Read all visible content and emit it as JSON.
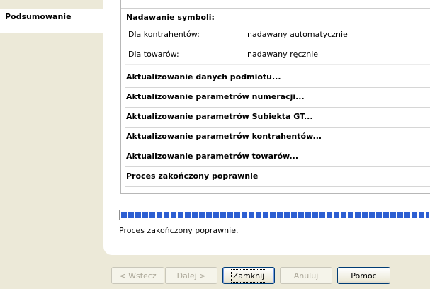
{
  "nav": {
    "items": [
      {
        "label": "Podsumowanie"
      }
    ]
  },
  "log": {
    "items": [
      {
        "type": "header",
        "label": "Nadawanie symboli:"
      },
      {
        "type": "kv",
        "key": "Dla kontrahentów:",
        "value": "nadawany automatycznie"
      },
      {
        "type": "kv",
        "key": "Dla towarów:",
        "value": "nadawany ręcznie"
      },
      {
        "type": "header",
        "label": "Aktualizowanie danych podmiotu..."
      },
      {
        "type": "header",
        "label": "Aktualizowanie parametrów numeracji..."
      },
      {
        "type": "header",
        "label": "Aktualizowanie parametrów Subiekta GT..."
      },
      {
        "type": "header",
        "label": "Aktualizowanie parametrów kontrahentów..."
      },
      {
        "type": "header",
        "label": "Aktualizowanie parametrów towarów..."
      },
      {
        "type": "header",
        "label": "Proces zakończony poprawnie"
      }
    ]
  },
  "progress": {
    "value": 1.0,
    "color": "#2d5fd2"
  },
  "status": {
    "text": "Proces zakończony poprawnie."
  },
  "buttons": {
    "back": "< Wstecz",
    "next": "Dalej >",
    "close": "Zamknij",
    "cancel": "Anuluj",
    "help": "Pomoc"
  },
  "colors": {
    "window_bg": "#ece9d8",
    "panel_bg": "#ffffff",
    "button_border": "#003c74"
  }
}
